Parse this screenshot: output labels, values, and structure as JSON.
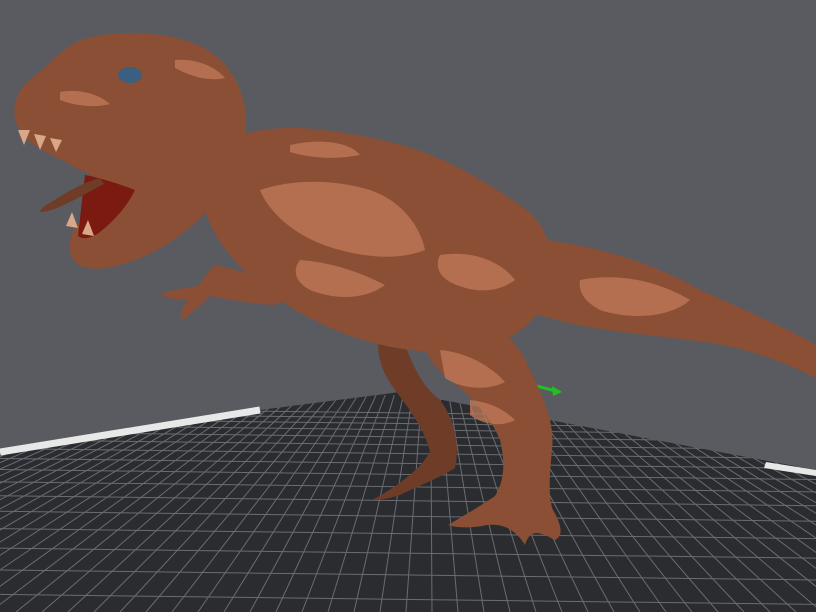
{
  "app": {
    "view": "3d-print-preparation-viewport"
  },
  "scene": {
    "background_color": "#595b61",
    "build_plate": {
      "color": "#2b2c30",
      "grid_color": "#6a6c72",
      "edge_color": "#e8e8e8"
    },
    "model": {
      "subject": "tyrannosaurus-rex",
      "base_color": "#8a4f35",
      "highlight_color": "#c07a58",
      "mouth_color": "#7a1a10",
      "eye_color": "#3a5f80"
    },
    "axes": {
      "x_color": "#22c022",
      "y_color": "#2244ff",
      "z_color": "#ff2222"
    }
  }
}
